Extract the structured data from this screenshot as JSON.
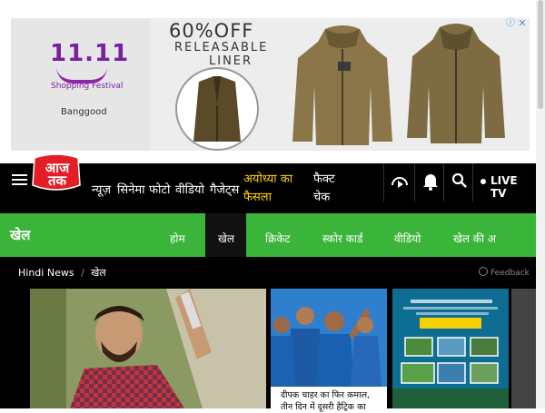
{
  "ad": {
    "promo_number": "11.11",
    "promo_title": "Shopping Festival",
    "promo_brand": "Banggood",
    "headline": "60%OFF",
    "subline_1": "RELEASABLE",
    "subline_2": "LINER",
    "close_label": "✕",
    "info_label": "ⓘ"
  },
  "logo": {
    "text": "आज तक"
  },
  "nav": {
    "items": [
      "न्यूज़",
      "सिनेमा",
      "फोटो",
      "वीडियो",
      "गैजेट्स"
    ],
    "highlight": "अयोध्या का फैसला",
    "fact_check": "फैक्ट चेक",
    "live_tv": "LIVE TV"
  },
  "section": {
    "title": "खेल",
    "tabs": [
      "होम",
      "खेल",
      "क्रिकेट",
      "स्कोर कार्ड",
      "वीडियो",
      "खेल की अ"
    ]
  },
  "breadcrumb": {
    "home": "Hindi News",
    "separator": "/",
    "current": "खेल"
  },
  "feedback": "Feedback",
  "cards": {
    "card2_caption": "दीपक चाहर का फिर कमाल, तीन दिन में दूसरी हैट्रिक का"
  },
  "colors": {
    "nav_bg": "#000000",
    "sports_green": "#3ab53a",
    "highlight": "#ffd400",
    "logo_red": "#e41e26"
  }
}
